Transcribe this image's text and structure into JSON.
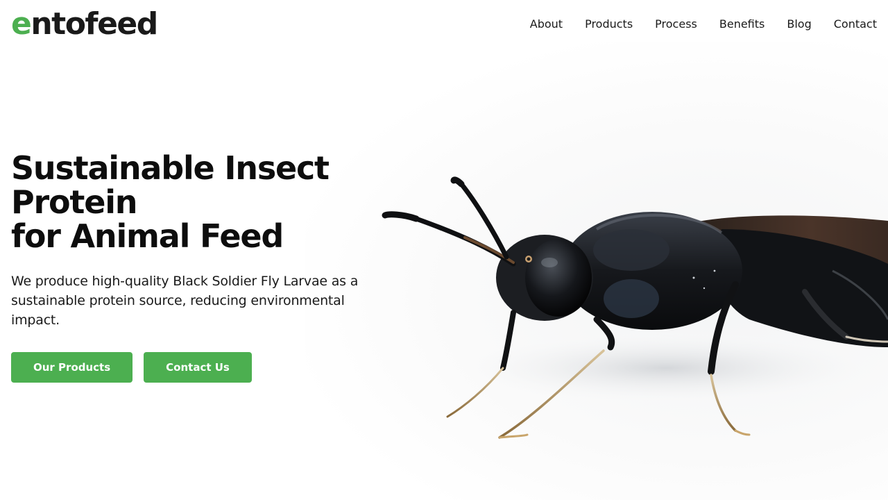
{
  "brand": {
    "name_first": "e",
    "name_rest": "ntofeed",
    "accent_color": "#4caf50"
  },
  "nav": {
    "items": [
      {
        "label": "About"
      },
      {
        "label": "Products"
      },
      {
        "label": "Process"
      },
      {
        "label": "Benefits"
      },
      {
        "label": "Blog"
      },
      {
        "label": "Contact"
      }
    ]
  },
  "hero": {
    "title_line1": "Sustainable Insect Protein",
    "title_line2": "for Animal Feed",
    "subtitle": "We produce high-quality Black Soldier Fly Larvae as a sustainable protein source, reducing environmental impact.",
    "primary_button": "Our Products",
    "secondary_button": "Contact Us",
    "image_subject": "black-soldier-fly"
  }
}
